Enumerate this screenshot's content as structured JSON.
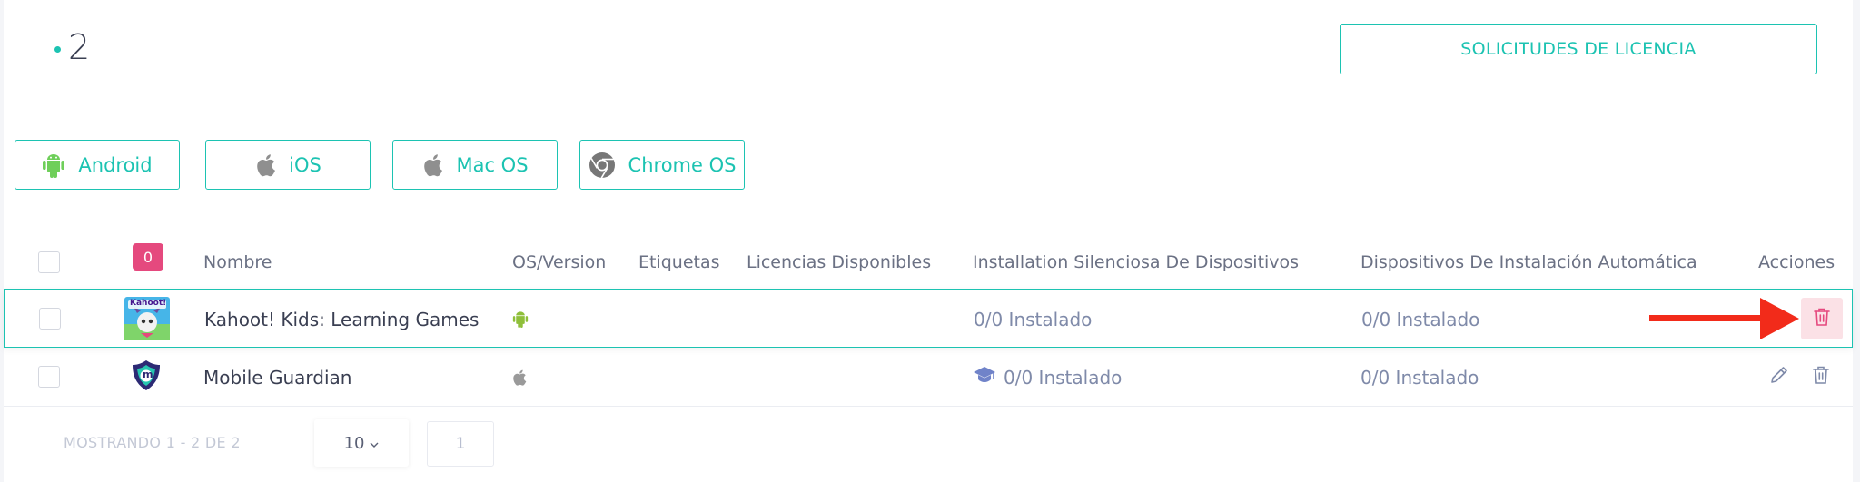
{
  "header": {
    "count": "2",
    "license_button": "SOLICITUDES DE LICENCIA"
  },
  "os_filters": [
    {
      "label": "Android",
      "icon": "android-icon",
      "color": "#6fcf5a"
    },
    {
      "label": "iOS",
      "icon": "apple-icon",
      "color": "#8f8f8f"
    },
    {
      "label": "Mac OS",
      "icon": "apple-icon",
      "color": "#8f8f8f"
    },
    {
      "label": "Chrome OS",
      "icon": "chrome-icon",
      "color": "#777777"
    }
  ],
  "table": {
    "selected_count": "0",
    "columns": [
      "Nombre",
      "OS/Version",
      "Etiquetas",
      "Licencias Disponibles",
      "Installation Silenciosa De Dispositivos",
      "Dispositivos De Instalación Automática",
      "Acciones"
    ],
    "rows": [
      {
        "name": "Kahoot! Kids: Learning Games",
        "icon_text": "Kahoot!",
        "os_icon": "android-icon",
        "silent": "0/0 Instalado",
        "auto": "0/0 Instalado",
        "selected": true
      },
      {
        "name": "Mobile Guardian",
        "icon_text": "m",
        "os_icon": "apple-icon",
        "silent": "0/0 Instalado",
        "auto": "0/0 Instalado",
        "selected": false
      }
    ]
  },
  "footer": {
    "showing": "MOSTRANDO 1 - 2 DE 2",
    "per_page": "10",
    "page": "1"
  },
  "colors": {
    "accent": "#1cc3b2",
    "badge": "#e5497e",
    "delete": "#e5497e",
    "arrow": "#f22b1a"
  }
}
